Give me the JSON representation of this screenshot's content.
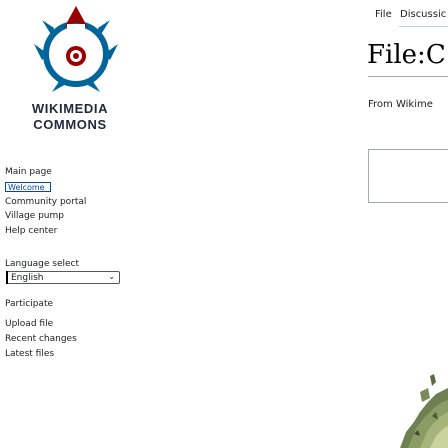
{
  "logo": {
    "line1": "WIKIMEDIA",
    "line2": "COMMONS",
    "icon": "wikimedia-commons-logo"
  },
  "sidebar": {
    "main_page": "Main page",
    "welcome": "Welcome",
    "community_portal": "Community portal",
    "village_pump": "Village pump",
    "help_center": "Help center",
    "language_select_heading": "Language select",
    "language_value": "English",
    "participate_heading": "Participate",
    "upload_file": "Upload file",
    "recent_changes": "Recent changes",
    "latest_files": "Latest files"
  },
  "tabs": {
    "file": "File",
    "discussion": "Discussic"
  },
  "page": {
    "title": "File:C",
    "from": "From Wikime"
  },
  "colors": {
    "link": "#0645ad",
    "logo_text": "#1f2a3a",
    "logo_fill": "#069"
  }
}
